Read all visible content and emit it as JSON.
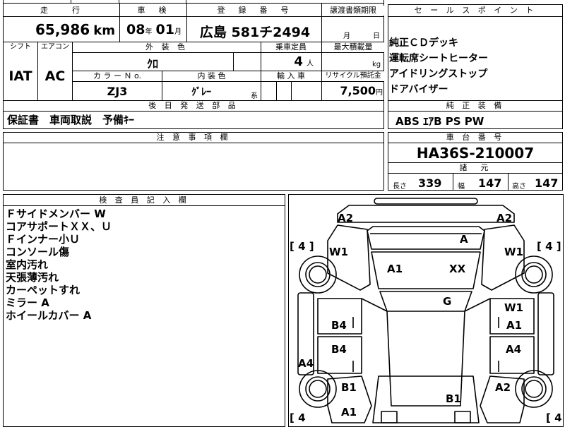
{
  "header": {
    "distance_label": "走　　行",
    "inspection_label": "車　検",
    "registration_label": "登　録　番　号",
    "transfer_label": "譲渡書類期限",
    "selling_points_label": "セ ー ル ス ポ イ ン ト"
  },
  "mileage": {
    "value": "65,986",
    "unit": "km"
  },
  "inspection": {
    "year": "08",
    "year_unit": "年",
    "month": "01",
    "month_unit": "月"
  },
  "registration": {
    "number": "広島 581チ2494"
  },
  "transfer": {
    "month_unit": "月",
    "day_unit": "日"
  },
  "spec": {
    "shift_label": "シフト",
    "aircon_label": "エアコン",
    "exterior_label": "外 装 色",
    "capacity_label": "乗車定員",
    "maxload_label": "最大積載量",
    "shift": "IAT",
    "aircon": "AC",
    "exterior_color": "ｸﾛ",
    "capacity": "4",
    "capacity_unit": "人",
    "maxload_unit": "kg",
    "color_no_label": "カ ラ ー Ｎ o.",
    "interior_label": "内 装 色",
    "import_label": "輸 入 車",
    "recycle_label": "リサイクル預託金",
    "color_no": "ZJ3",
    "interior_color": "ｸﾞﾚｰ",
    "interior_suffix": "系",
    "recycle_fee": "7,500",
    "recycle_unit": "円"
  },
  "delivery": {
    "label": "後 日 発 送 部 品",
    "items": "保証書　車両取説　予備ｷｰ"
  },
  "caution": {
    "label": "注 意 事 項 欄"
  },
  "selling_points": [
    "純正ＣＤデッキ",
    "運転席シートヒーター",
    "アイドリングストップ",
    "ドアバイザー"
  ],
  "genuine": {
    "label": "純 正 装 備",
    "items": "ABS ｴｱB PS PW"
  },
  "chassis": {
    "label": "車 台 番 号",
    "number": "HA36S-210007"
  },
  "dimensions": {
    "label": "諸　元",
    "length_label": "長さ",
    "length": "339",
    "width_label": "幅",
    "width": "147",
    "height_label": "高さ",
    "height": "147"
  },
  "inspector": {
    "label": "検 査 員 記 入 欄",
    "notes": [
      "Ｆサイドメンバー W",
      "コアサポートＸＸ、Ｕ",
      "Ｆインナー小Ｕ",
      "コンソール傷",
      "室内汚れ",
      "天張薄汚れ",
      "カーペットすれ",
      "ミラー A",
      "ホイールカバー A"
    ]
  },
  "diagram": {
    "tire_fl": "[ 4 ]",
    "tire_fr": "[ 4 ]",
    "tire_rl": "[ 4",
    "tire_rr": "[ 4",
    "labels": {
      "bumper_fl": "A2",
      "bumper_fr": "A2",
      "hood_a": "A",
      "fender_l": "W1",
      "fender_r": "W1",
      "windshield": "A1",
      "roof_xx": "XX",
      "roof_g": "G",
      "door_fr_w": "W1",
      "door_fr_a": "A1",
      "door_fl": "B4",
      "door_rl": "B4",
      "door_rr": "A4",
      "rocker_l": "A4",
      "quarter_l": "B1",
      "quarter_r": "A2",
      "rear_glass": "B1",
      "rear_bumper": "A1"
    }
  }
}
